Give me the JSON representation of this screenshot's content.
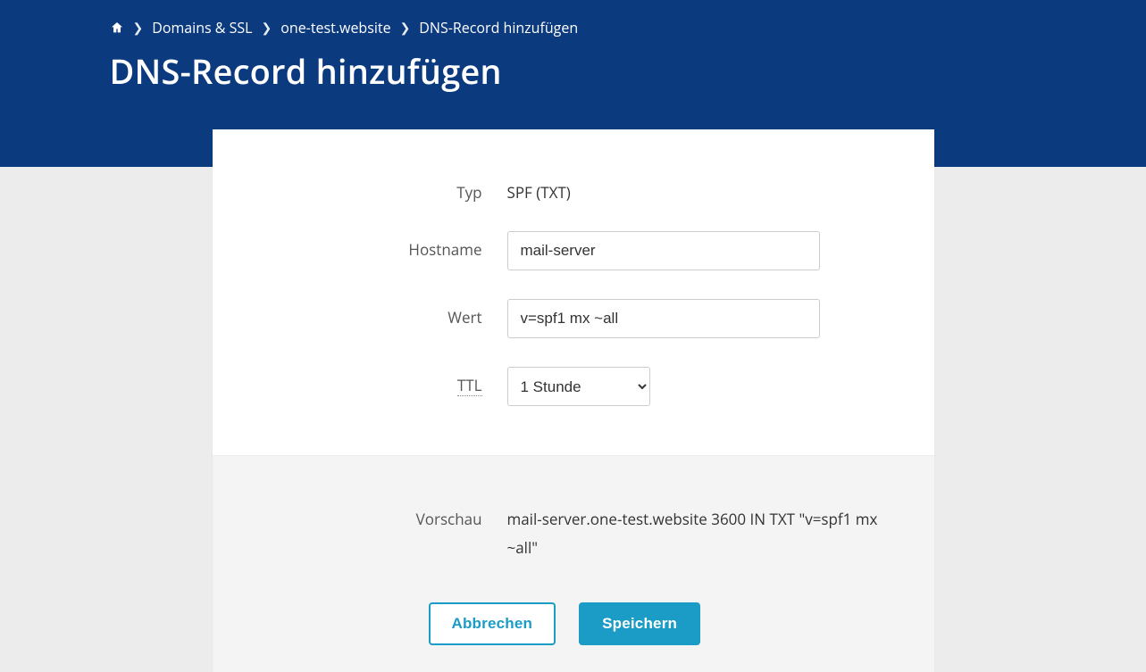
{
  "breadcrumb": {
    "items": [
      {
        "label": "Domains & SSL"
      },
      {
        "label": "one-test.website"
      },
      {
        "label": "DNS-Record hinzufügen"
      }
    ]
  },
  "page": {
    "title": "DNS-Record hinzufügen"
  },
  "form": {
    "type_label": "Typ",
    "type_value": "SPF (TXT)",
    "hostname_label": "Hostname",
    "hostname_value": "mail-server",
    "value_label": "Wert",
    "value_value": "v=spf1 mx ~all",
    "ttl_label": "TTL",
    "ttl_selected": "1 Stunde"
  },
  "preview": {
    "label": "Vorschau",
    "text": "mail-server.one-test.website  3600  IN  TXT \"v=spf1 mx ~all\""
  },
  "buttons": {
    "cancel": "Abbrechen",
    "save": "Speichern"
  }
}
